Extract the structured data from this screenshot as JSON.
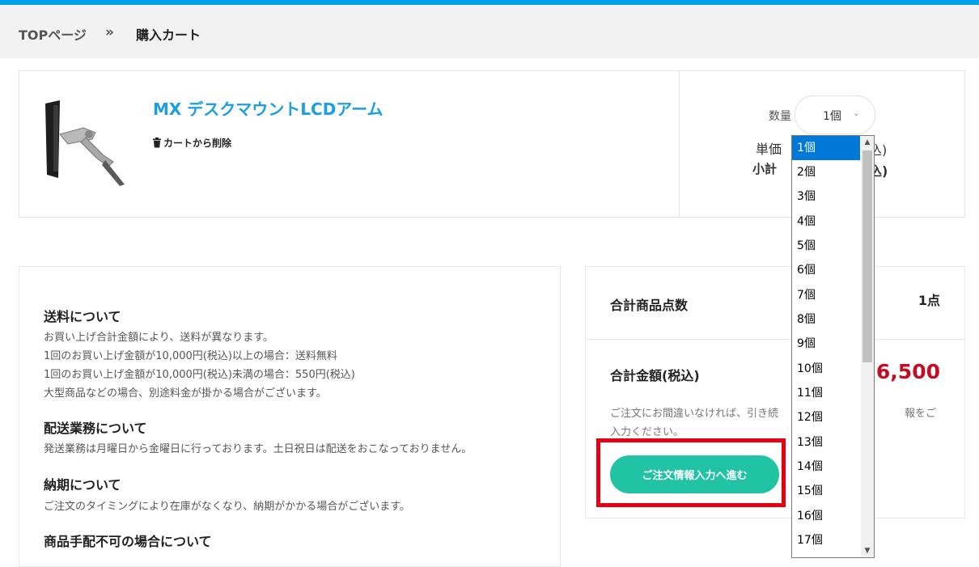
{
  "breadcrumb": {
    "home": "TOPページ",
    "separator": "»",
    "current": "購入カート"
  },
  "cart_item": {
    "name": "MX デスクマウントLCDアーム",
    "remove_label": "カートから削除",
    "quantity_label": "数量",
    "quantity_value": "1個",
    "unit_price_label": "単価",
    "unit_price_value_visible": "込)",
    "subtotal_label": "小計",
    "subtotal_value_visible": "込)"
  },
  "info": {
    "shipping_title": "送料について",
    "shipping_lines": [
      "お買い上げ合計金額により、送料が異なります。",
      "1回のお買い上げ金額が10,000円(税込)以上の場合：送料無料",
      "1回のお買い上げ金額が10,000円(税込)未満の場合：550円(税込)",
      "大型商品などの場合、別途料金が掛かる場合がございます。"
    ],
    "delivery_title": "配送業務について",
    "delivery_text": "発送業務は月曜日から金曜日に行っております。土日祝日は配送をおこなっておりません。",
    "leadtime_title": "納期について",
    "leadtime_text": "ご注文のタイミングにより在庫がなくなり、納期がかかる場合がございます。",
    "unavailable_title": "商品手配不可の場合について"
  },
  "summary": {
    "count_label": "合計商品点数",
    "count_value": "1点",
    "total_label": "合計金額(税込)",
    "total_value_visible": "16,500",
    "note_visible": "ご注文にお間違いなければ、引き続　　　　　　　　　　　　報をご入力ください。",
    "proceed_button": "ご注文情報入力へ進む"
  },
  "quantity_dropdown": {
    "selected": "1個",
    "options": [
      "1個",
      "2個",
      "3個",
      "4個",
      "5個",
      "6個",
      "7個",
      "8個",
      "9個",
      "10個",
      "11個",
      "12個",
      "13個",
      "14個",
      "15個",
      "16個",
      "17個"
    ]
  },
  "colors": {
    "accent_blue": "#00a0e9",
    "link_blue": "#1a9fe3",
    "cta_green": "#20c3a3",
    "price_red": "#c30d23",
    "highlight_red": "#e60012",
    "select_blue": "#0078d7"
  }
}
